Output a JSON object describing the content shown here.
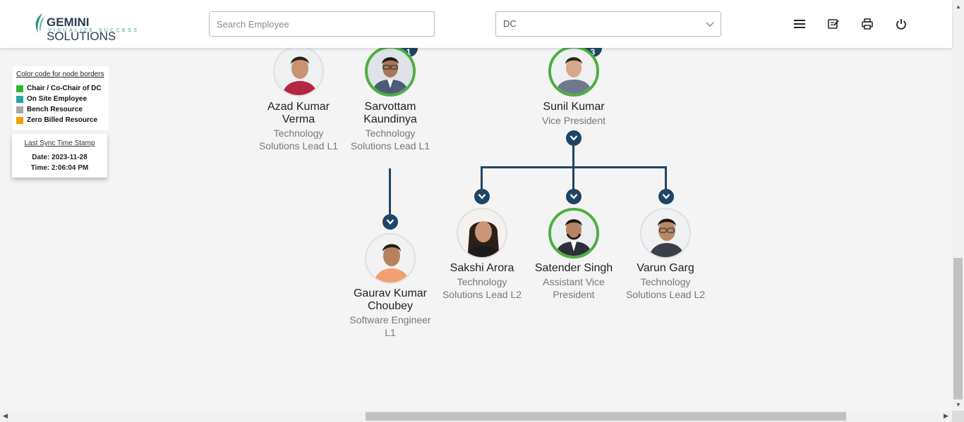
{
  "header": {
    "logo_main_bold": "GEMINI",
    "logo_main_rest": " SOLUTIONS",
    "logo_tagline": "VISUALIZE SUCCESS",
    "search_placeholder": "Search Employee",
    "department_select": "DC",
    "icons": [
      "menu-icon",
      "edit-notes-icon",
      "print-icon",
      "power-icon"
    ]
  },
  "legend": {
    "title": "Color code for node borders",
    "items": [
      {
        "label": "Chair / Co-Chair of DC",
        "color": "#2eb82e"
      },
      {
        "label": "On Site Employee",
        "color": "#2aa3a3"
      },
      {
        "label": "Bench Resource",
        "color": "#a8a8a8"
      },
      {
        "label": "Zero Billed Resource",
        "color": "#f5a300"
      }
    ]
  },
  "sync": {
    "title": "Last Sync Time Stamp",
    "date": "Date: 2023-11-28",
    "time": "Time: 2:06:04 PM"
  },
  "colors": {
    "connector": "#1e4566",
    "chair_border": "#4caf3f"
  },
  "employees": [
    {
      "name": "Azad Kumar Verma",
      "title": "Technology Solutions Lead L1",
      "border": "plain"
    },
    {
      "name": "Sarvottam Kaundinya",
      "title": "Technology Solutions Lead L1",
      "border": "green",
      "reports": "1"
    },
    {
      "name": "Sunil Kumar",
      "title": "Vice President",
      "border": "green",
      "reports": "3"
    },
    {
      "name": "Gaurav Kumar Choubey",
      "title": "Software Engineer L1",
      "border": "plain"
    },
    {
      "name": "Sakshi Arora",
      "title": "Technology Solutions Lead L2",
      "border": "plain"
    },
    {
      "name": "Satender Singh",
      "title": "Assistant Vice President",
      "border": "green"
    },
    {
      "name": "Varun Garg",
      "title": "Technology Solutions Lead L2",
      "border": "plain"
    }
  ]
}
